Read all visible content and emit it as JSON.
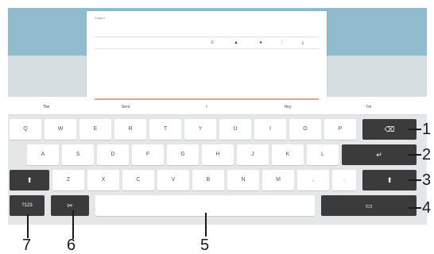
{
  "email_preview": {
    "subject_label": "Subject",
    "toolbar_icons": [
      "format-icon",
      "attach-icon",
      "star-icon",
      "more-icon",
      "download-icon"
    ]
  },
  "suggestions": [
    "The",
    "Sent",
    "I",
    "Hey",
    "I'm"
  ],
  "keyboard": {
    "row1": [
      "Q",
      "W",
      "E",
      "R",
      "T",
      "Y",
      "U",
      "I",
      "O",
      "P"
    ],
    "row2": [
      "A",
      "S",
      "D",
      "F",
      "G",
      "H",
      "J",
      "K",
      "L"
    ],
    "row3": [
      "Z",
      "X",
      "C",
      "V",
      "B",
      "N",
      "M",
      ",",
      "."
    ],
    "symbols_label": "?123",
    "colors": {
      "light_key": "#ffffff",
      "dark_key": "#3b3b3b",
      "keyboard_bg": "#e4e6e7",
      "accent": "#90bccd"
    }
  },
  "callouts": {
    "c1": "1",
    "c2": "2",
    "c3": "3",
    "c4": "4",
    "c5": "5",
    "c6": "6",
    "c7": "7"
  }
}
